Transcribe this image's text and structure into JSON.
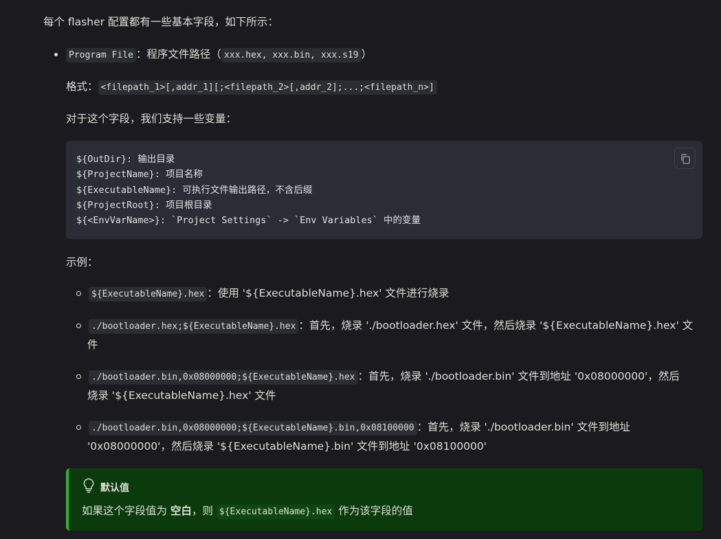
{
  "intro": "每个 flasher 配置都有一些基本字段，如下所示：",
  "field": {
    "name": "Program File",
    "desc_prefix": "：程序文件路径（",
    "extensions": "xxx.hex, xxx.bin, xxx.s19",
    "desc_suffix": "）"
  },
  "format": {
    "label": "格式：",
    "value": "<filepath_1>[,addr_1][;<filepath_2>[,addr_2];...;<filepath_n>]"
  },
  "variables_intro": "对于这个字段，我们支持一些变量：",
  "code_block": {
    "lines": [
      "${OutDir}: 输出目录",
      "${ProjectName}: 项目名称",
      "${ExecutableName}: 可执行文件输出路径，不含后缀",
      "${ProjectRoot}: 项目根目录",
      "${<EnvVarName>}: `Project Settings` -> `Env Variables` 中的变量"
    ],
    "copy_icon": "copy-icon"
  },
  "examples_label": "示例：",
  "examples": [
    {
      "code": "${ExecutableName}.hex",
      "text_1": "：使用 '${ExecutableName}.hex' 文件进行烧录",
      "text_2": ""
    },
    {
      "code": "./bootloader.hex;${ExecutableName}.hex",
      "text_1": "：首先，烧录 './bootloader.hex' 文件，然后烧录 '${ExecutableName}.hex' 文",
      "text_2": "件"
    },
    {
      "code": "./bootloader.bin,0x08000000;${ExecutableName}.hex",
      "text_1": "：首先，烧录 './bootloader.bin' 文件到地址 '0x08000000'，然后",
      "text_2": "烧录 '${ExecutableName}.hex' 文件"
    },
    {
      "code": "./bootloader.bin,0x08000000;${ExecutableName}.bin,0x08100000",
      "text_1": "：首先，烧录 './bootloader.bin' 文件到地址",
      "text_2": "'0x08000000'，然后烧录 '${ExecutableName}.bin' 文件到地址 '0x08100000'"
    }
  ],
  "tip": {
    "icon": "lightbulb-icon",
    "title": "默认值",
    "body_prefix": "如果这个字段值为 ",
    "body_bold": "空白",
    "body_middle": "，则 ",
    "body_code": "${ExecutableName}.hex",
    "body_suffix": " 作为该字段的值"
  },
  "colors": {
    "background": "#1b1b1f",
    "code_bg": "#2a2c36",
    "tip_bg": "#0b3b0d",
    "tip_border": "#2fb338"
  }
}
